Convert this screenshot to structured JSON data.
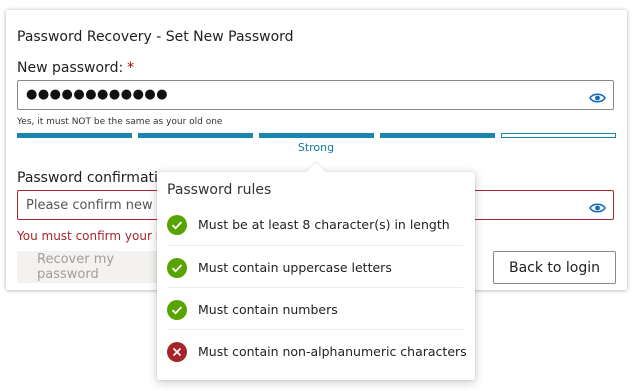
{
  "form": {
    "title": "Password Recovery - Set New Password",
    "new_password_label": "New password:",
    "required_marker": "*",
    "new_password_value": "●●●●●●●●●●●●",
    "hint": "Yes, it must NOT be the same as your old one",
    "strength_label": "Strength",
    "strength_value": "Strong",
    "confirm_label": "Password confirmation",
    "confirm_placeholder": "Please confirm new password",
    "confirm_error": "You must confirm your new password",
    "recover_button": "Recover my password",
    "back_button": "Back to login"
  },
  "strength": {
    "filled_segments": 4,
    "total_segments": 5,
    "color": "#1a86b0"
  },
  "rules_popup": {
    "title": "Password rules",
    "rules": [
      {
        "text": "Must be at least 8 character(s) in length",
        "status": "pass",
        "icon": "check-circle-icon"
      },
      {
        "text": "Must contain uppercase letters",
        "status": "pass",
        "icon": "check-circle-icon"
      },
      {
        "text": "Must contain numbers",
        "status": "pass",
        "icon": "check-circle-icon"
      },
      {
        "text": "Must contain non-alphanumeric characters",
        "status": "fail",
        "icon": "x-circle-icon"
      }
    ]
  },
  "colors": {
    "accent": "#0f6cbd",
    "pass": "#57a300",
    "fail": "#a4262c",
    "error_text": "#a4262c"
  }
}
